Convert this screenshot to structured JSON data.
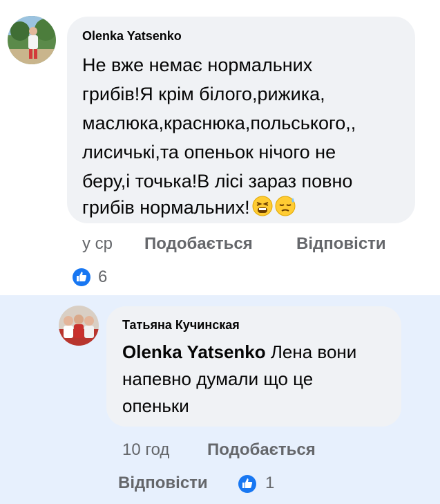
{
  "comment1": {
    "author": "Olenka Yatsenko",
    "lines": [
      "Не вже немає нормальних",
      "грибів!Я крім білого,рижика,",
      "маслюка,краснюка,польського,,",
      "лисичькі,та опеньок нічого не",
      "беру,і точька!В лісі  зараз повно",
      "грибів нормальних!"
    ],
    "emoji": [
      "tired-face-emoji",
      "downcast-sweat-face-emoji"
    ],
    "time": "у ср",
    "like_label": "Подобається",
    "reply_label": "Відповісти",
    "reaction_icon": "like-icon",
    "reaction_count": "6"
  },
  "comment2": {
    "author": "Татьяна Кучинская",
    "mention": "Olenka Yatsenko",
    "line1_rest": " Лена вони",
    "lines": [
      "напевно думали що це",
      "опеньки"
    ],
    "time": "10 год",
    "like_label": "Подобається",
    "reply_label": "Відповісти",
    "reaction_icon": "like-icon",
    "reaction_count": "1"
  },
  "colors": {
    "bubble": "#f0f2f5",
    "reply_highlight": "#e7f0fd",
    "text": "#050505",
    "meta": "#65676b",
    "like_blue": "#1877f2"
  }
}
